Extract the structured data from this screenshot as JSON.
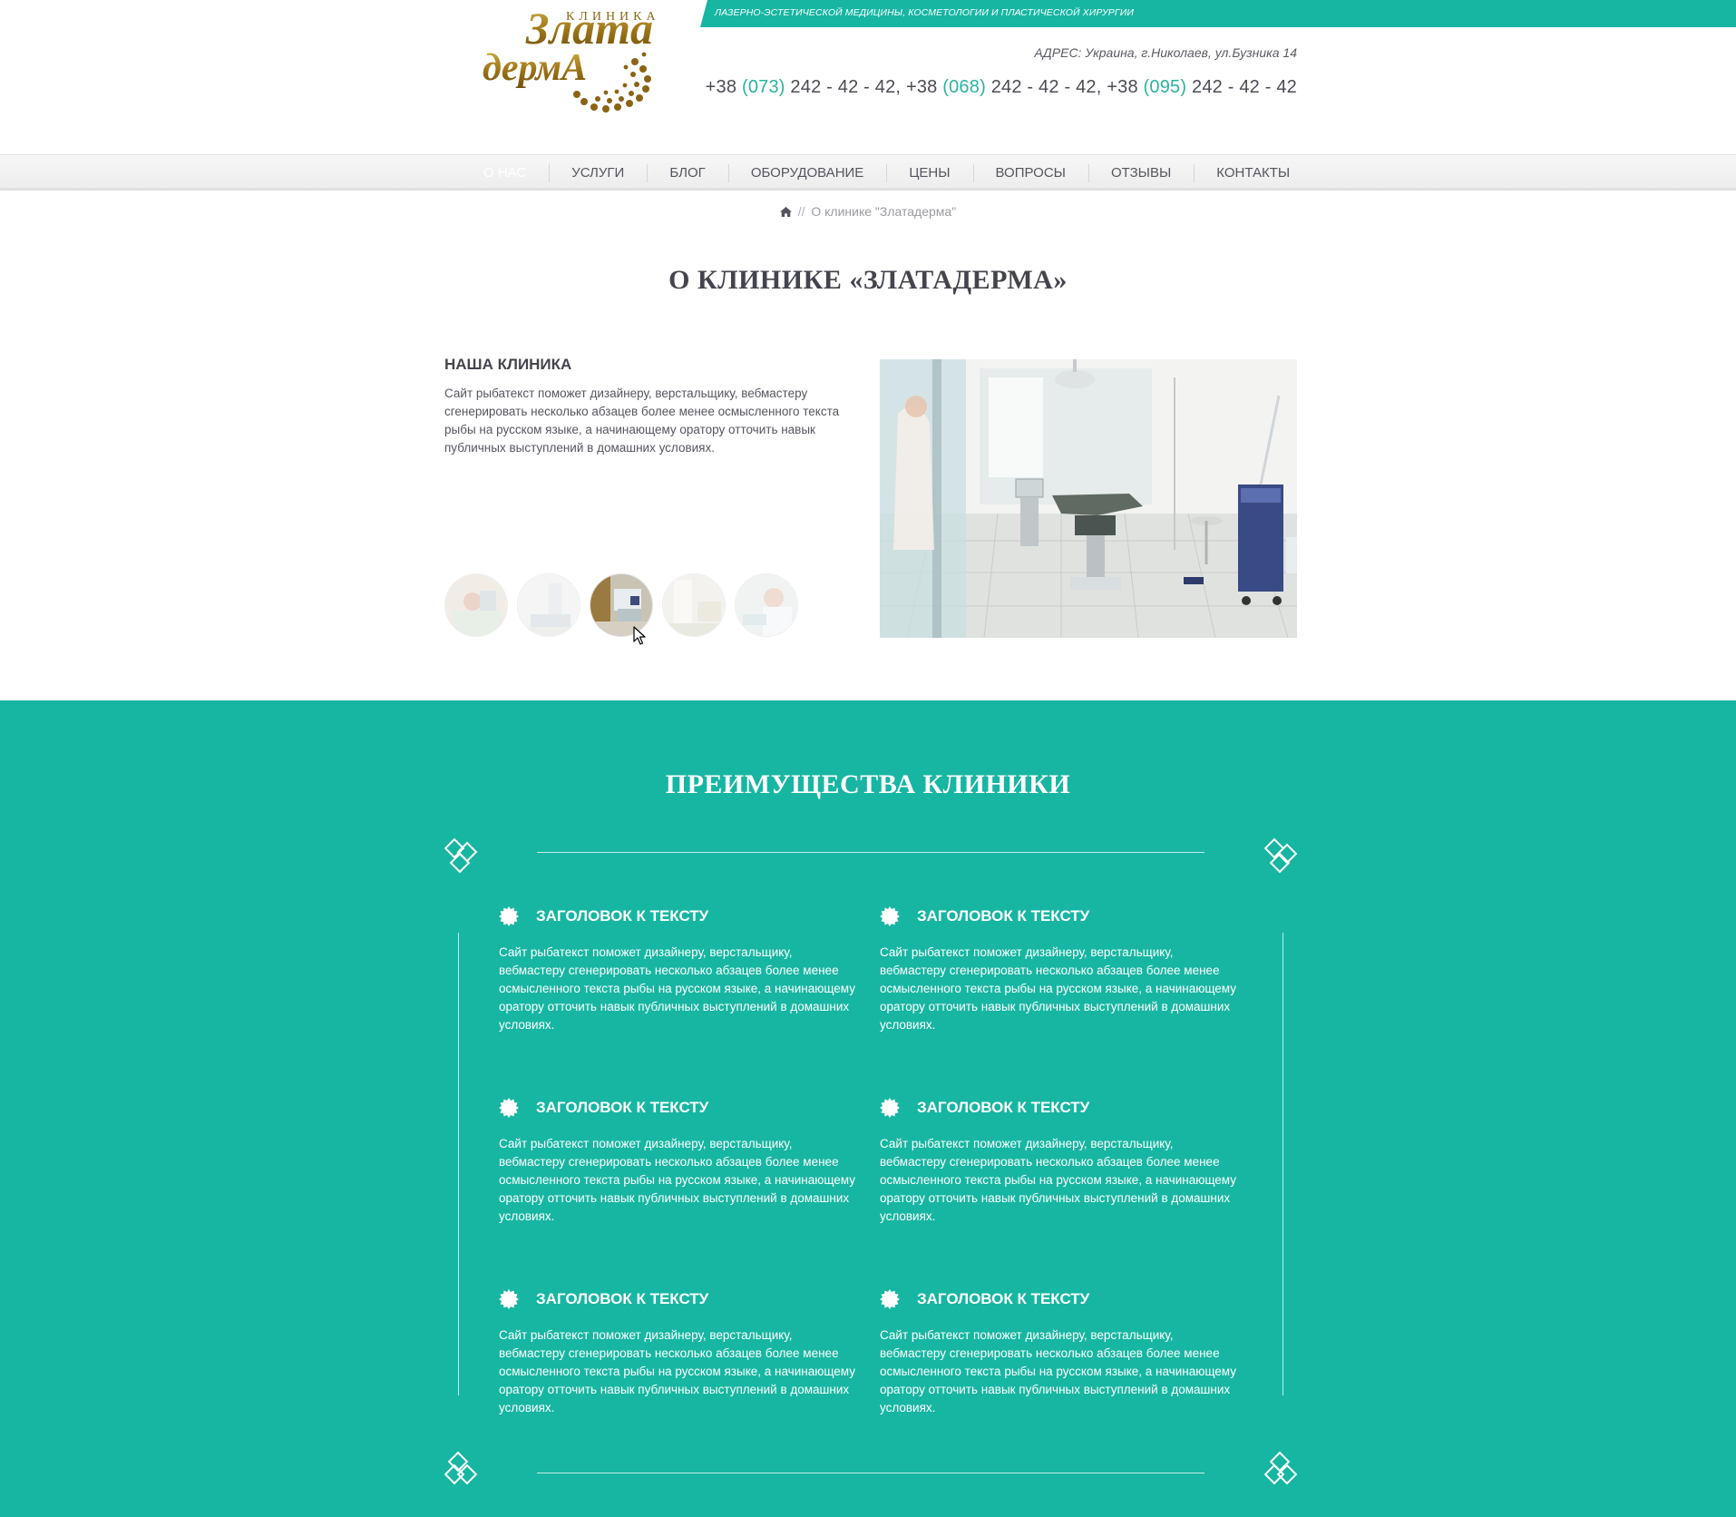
{
  "header": {
    "logo": {
      "word_top": "КЛИНИКА",
      "word_main_1": "Злата",
      "word_main_2": "дермА"
    },
    "tagline": "ЛАЗЕРНО-ЭСТЕТИЧЕСКОЙ МЕДИЦИНЫ, КОСМЕТОЛОГИИ И ПЛАСТИЧЕСКОЙ ХИРУРГИИ",
    "address": "АДРЕС: Украина, г.Николаев, ул.Бузника 14",
    "phones": [
      {
        "prefix": "+38 ",
        "code": "(073)",
        "number": " 242 - 42 - 42,"
      },
      {
        "prefix": " +38 ",
        "code": "(068)",
        "number": " 242 - 42 - 42,"
      },
      {
        "prefix": " +38 ",
        "code": "(095)",
        "number": " 242 - 42 - 42"
      }
    ]
  },
  "nav": {
    "items": [
      {
        "label": "О НАС",
        "active": true
      },
      {
        "label": "УСЛУГИ"
      },
      {
        "label": "БЛОГ"
      },
      {
        "label": "ОБОРУДОВАНИЕ"
      },
      {
        "label": "ЦЕНЫ"
      },
      {
        "label": "ВОПРОСЫ"
      },
      {
        "label": "ОТЗЫВЫ"
      },
      {
        "label": "КОНТАКТЫ"
      }
    ]
  },
  "breadcrumb": {
    "home_icon": "home-icon",
    "separator": "//",
    "current": "О клинике \"Златадерма\""
  },
  "about": {
    "title": "О КЛИНИКЕ «ЗЛАТАДЕРМА»",
    "heading": "НАША КЛИНИКА",
    "text": "Сайт рыбатекст поможет дизайнеру, верстальщику, вебмастеру сгенерировать несколько абзацев более менее осмысленного текста рыбы на русском языке, а начинающему оратору отточить навык публичных выступлений в домашних условиях.",
    "thumbnail_count": 5,
    "active_thumbnail": 3
  },
  "advantages": {
    "title": "ПРЕИМУЩЕСТВА КЛИНИКИ",
    "items": [
      {
        "heading": "ЗАГОЛОВОК К ТЕКСТУ",
        "text": "Сайт рыбатекст поможет дизайнеру, верстальщику, вебмастеру сгенерировать несколько абзацев более менее осмысленного текста рыбы на русском языке, а начинающему оратору отточить навык публичных выступлений в домашних условиях."
      },
      {
        "heading": "ЗАГОЛОВОК К ТЕКСТУ",
        "text": "Сайт рыбатекст поможет дизайнеру, верстальщику, вебмастеру сгенерировать несколько абзацев более менее осмысленного текста рыбы на русском языке, а начинающему оратору отточить навык публичных выступлений в домашних условиях."
      },
      {
        "heading": "ЗАГОЛОВОК К ТЕКСТУ",
        "text": "Сайт рыбатекст поможет дизайнеру, верстальщику, вебмастеру сгенерировать несколько абзацев более менее осмысленного текста рыбы на русском языке, а начинающему оратору отточить навык публичных выступлений в домашних условиях."
      },
      {
        "heading": "ЗАГОЛОВОК К ТЕКСТУ",
        "text": "Сайт рыбатекст поможет дизайнеру, верстальщику, вебмастеру сгенерировать несколько абзацев более менее осмысленного текста рыбы на русском языке, а начинающему оратору отточить навык публичных выступлений в домашних условиях."
      },
      {
        "heading": "ЗАГОЛОВОК К ТЕКСТУ",
        "text": "Сайт рыбатекст поможет дизайнеру, верстальщику, вебмастеру сгенерировать несколько абзацев более менее осмысленного текста рыбы на русском языке, а начинающему оратору отточить навык публичных выступлений в домашних условиях."
      },
      {
        "heading": "ЗАГОЛОВОК К ТЕКСТУ",
        "text": "Сайт рыбатекст поможет дизайнеру, верстальщику, вебмастеру сгенерировать несколько абзацев более менее осмысленного текста рыбы на русском языке, а начинающему оратору отточить навык публичных выступлений в домашних условиях."
      }
    ]
  },
  "colors": {
    "accent": "#17b6a2",
    "phone_code": "#2bb3a1",
    "text_dark": "#44444e",
    "logo_gold": "#a07a1c"
  }
}
